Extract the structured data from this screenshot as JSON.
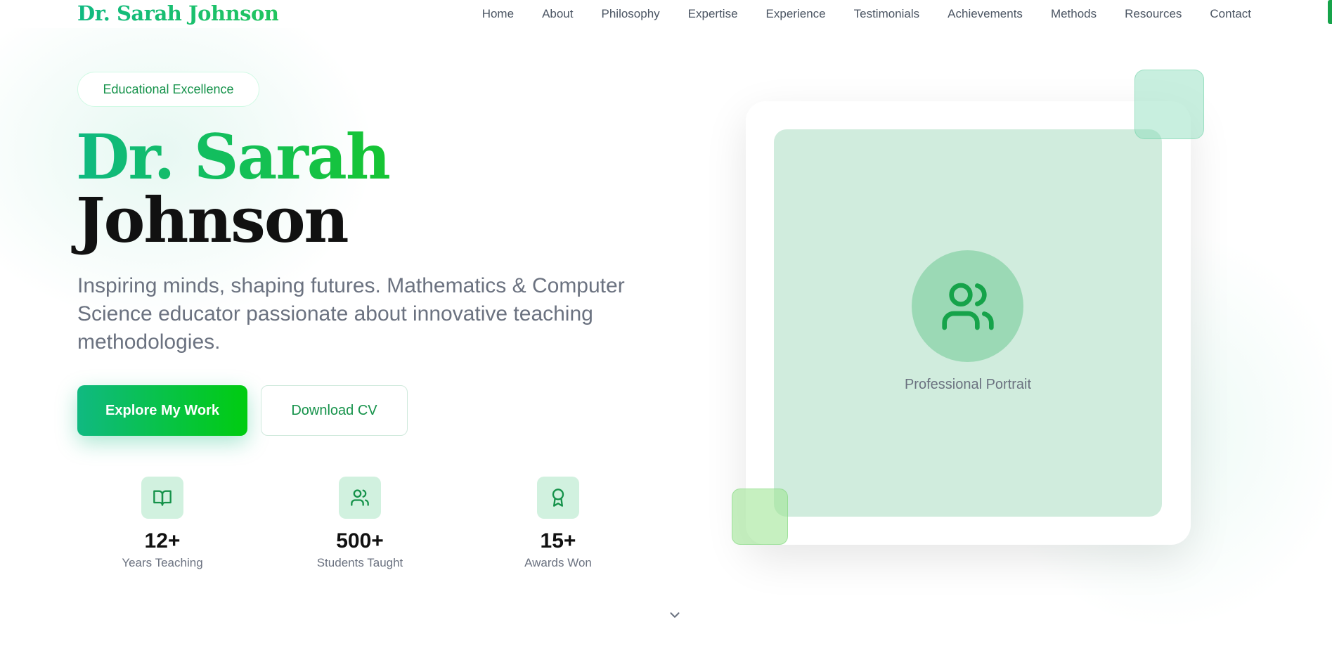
{
  "nav": {
    "logo": "Dr. Sarah Johnson",
    "links": [
      "Home",
      "About",
      "Philosophy",
      "Expertise",
      "Experience",
      "Testimonials",
      "Achievements",
      "Methods",
      "Resources",
      "Contact"
    ]
  },
  "hero": {
    "badge": "Educational Excellence",
    "name_line1": "Dr. Sarah",
    "name_line2": "Johnson",
    "subtitle": "Inspiring minds, shaping futures. Mathematics & Computer Science educator passionate about innovative teaching methodologies.",
    "primary_button": "Explore My Work",
    "secondary_button": "Download CV"
  },
  "stats": [
    {
      "icon": "book-open-icon",
      "value": "12+",
      "label": "Years Teaching"
    },
    {
      "icon": "users-icon",
      "value": "500+",
      "label": "Students Taught"
    },
    {
      "icon": "award-icon",
      "value": "15+",
      "label": "Awards Won"
    }
  ],
  "portrait": {
    "icon": "users-icon",
    "label": "Professional Portrait"
  },
  "scroll_indicator": {
    "icon": "chevron-down-icon"
  },
  "colors": {
    "accent": "#10b981",
    "accent_alt": "#00cc10",
    "accent_text": "#15924a",
    "tint": "#d0ecdd",
    "text_muted": "#6b7280"
  }
}
